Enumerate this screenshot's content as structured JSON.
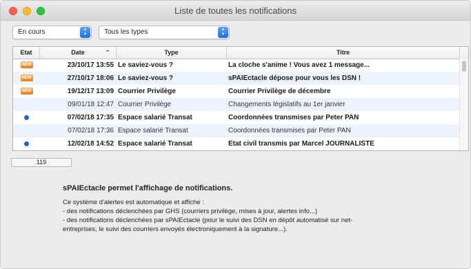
{
  "window": {
    "title": "Liste de toutes les notifications"
  },
  "filters": {
    "status": {
      "value": "En cours"
    },
    "type": {
      "value": "Tous les types"
    }
  },
  "table": {
    "columns": {
      "etat": "Etat",
      "date": "Date",
      "type": "Type",
      "titre": "Titre"
    },
    "rows": [
      {
        "etat": "new",
        "date": "23/10/17  13:55",
        "type": "Le saviez-vous ?",
        "titre": "La cloche s'anime ! Vous avez 1 message...",
        "bold": true
      },
      {
        "etat": "new",
        "date": "27/10/17  18:06",
        "type": "Le saviez-vous ?",
        "titre": "sPAIEctacle dépose pour vous les DSN !",
        "bold": true
      },
      {
        "etat": "new",
        "date": "19/12/17  13:09",
        "type": "Courrier Privilège",
        "titre": "Courrier Privilège de décembre",
        "bold": true
      },
      {
        "etat": "",
        "date": "09/01/18  12:47",
        "type": "Courrier Privilège",
        "titre": "Changements législatifs au 1er janvier",
        "bold": false
      },
      {
        "etat": "dot",
        "date": "07/02/18  17:35",
        "type": "Espace salarié Transat",
        "titre": "Coordonnées transmises par Peter PAN",
        "bold": true
      },
      {
        "etat": "",
        "date": "07/02/18  17:36",
        "type": "Espace salarié Transat",
        "titre": "Coordonnées transmises par Peter PAN",
        "bold": false
      },
      {
        "etat": "dot",
        "date": "12/02/18  14:52",
        "type": "Espace salarié Transat",
        "titre": "Etat civil transmis par Marcel JOURNALISTE",
        "bold": true
      }
    ],
    "new_badge_label": "NEW"
  },
  "count": "119",
  "info": {
    "heading": "sPAIEctacle permet l'affichage de notifications.",
    "lines": [
      "Ce système d'alertes est automatique et affiche :",
      "- des notifications déclenchées par GHS (courriers privilège, mises à jour, alertes info...)",
      "- des notifications déclenchées par sPAIEctacle (pour le suivi des DSN en dépôt automatisé sur net-",
      "entreprises, le suivi des courriers envoyés électroniquement à la signature...)."
    ]
  },
  "colors": {
    "new_badge": "#f07d22",
    "unread_dot": "#1e63c8",
    "row_alt": "#edf3fd",
    "popup_accent": "#1a6ff0"
  }
}
